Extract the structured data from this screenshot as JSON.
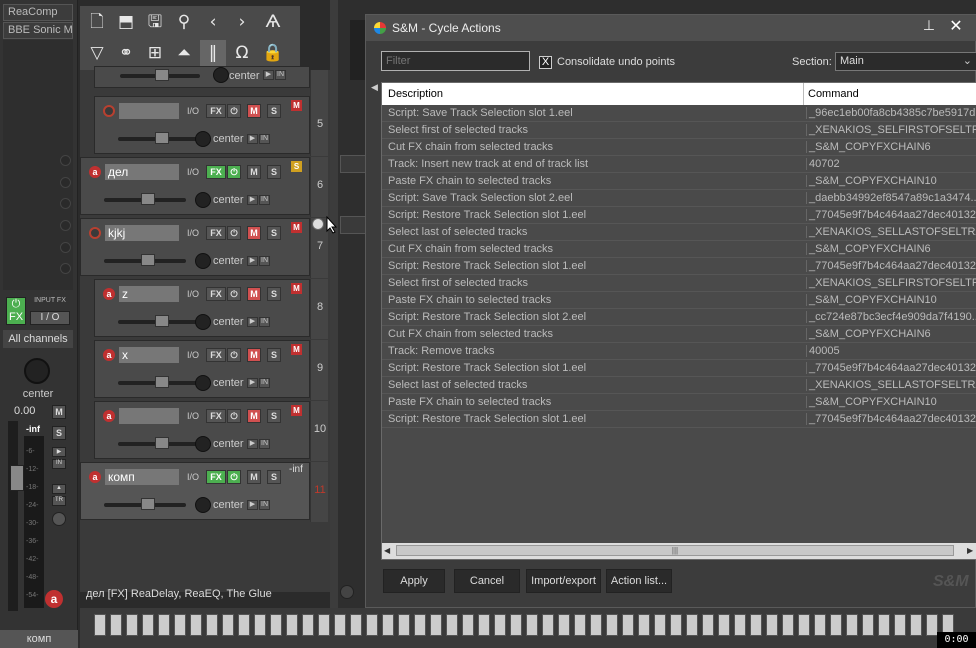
{
  "mixer": {
    "fx_slots": [
      "ReaComp",
      "BBE Sonic M"
    ],
    "fx_label": "FX",
    "input_fx_label": "INPUT FX",
    "io_label": "I / O",
    "all_channels": "All channels",
    "pan": "center",
    "volume": "0.00",
    "peak": "-inf",
    "m_label": "M",
    "s_label": "S",
    "in_label": "IN",
    "tr_label": "TR",
    "track_name": "комп",
    "scale": [
      "-6-",
      "-12-",
      "-18-",
      "-24-",
      "-30-",
      "-36-",
      "-42-",
      "-48-",
      "-54-"
    ]
  },
  "toolbar": {
    "row1": [
      "new-project",
      "open-project",
      "save-project",
      "attach",
      "back",
      "forward",
      "razor"
    ],
    "row2": [
      "filter",
      "link",
      "grid",
      "envelope",
      "snap-grid",
      "magnet",
      "lock"
    ]
  },
  "tracks": [
    {
      "num": "5",
      "name": "",
      "fx_on": false,
      "muted": true,
      "badge": "M"
    },
    {
      "num": "6",
      "name": "дел",
      "fx_on": true,
      "muted": false,
      "badge": "S"
    },
    {
      "num": "7",
      "name": "kjkj",
      "fx_on": false,
      "muted": true,
      "badge": "M"
    },
    {
      "num": "8",
      "name": "z",
      "fx_on": false,
      "muted": true,
      "badge": "M"
    },
    {
      "num": "9",
      "name": "x",
      "fx_on": false,
      "muted": true,
      "badge": "M"
    },
    {
      "num": "10",
      "name": "",
      "fx_on": false,
      "muted": true,
      "badge": "M"
    },
    {
      "num": "11",
      "name": "комп",
      "fx_on": true,
      "muted": false,
      "badge": "-inf"
    }
  ],
  "track_labels": {
    "io": "I/O",
    "fx": "FX",
    "m": "M",
    "s": "S",
    "center": "center",
    "in": "IN"
  },
  "status_bar": "дел [FX] ReaDelay, ReaEQ, The Glue",
  "dialog": {
    "title": "S&M - Cycle Actions",
    "filter_placeholder": "Filter",
    "consolidate_label": "Consolidate undo points",
    "consolidate_checked": "X",
    "section_label": "Section:",
    "section_value": "Main",
    "columns": {
      "description": "Description",
      "command": "Command"
    },
    "rows": [
      {
        "d": "Script: Save Track Selection slot 1.eel",
        "c": "_96ec1eb00fa8cb4385c7be5917d..."
      },
      {
        "d": "Select first of selected tracks",
        "c": "_XENAKIOS_SELFIRSTOFSELTRAX"
      },
      {
        "d": "Cut FX chain from selected tracks",
        "c": "_S&M_COPYFXCHAIN6"
      },
      {
        "d": "Track: Insert new track at end of track list",
        "c": "40702"
      },
      {
        "d": "Paste FX chain to selected tracks",
        "c": "_S&M_COPYFXCHAIN10"
      },
      {
        "d": "Script: Save Track Selection slot 2.eel",
        "c": "_daebb34992ef8547a89c1a3474..."
      },
      {
        "d": "Script: Restore Track Selection slot 1.eel",
        "c": "_77045e9f7b4c464aa27dec40132..."
      },
      {
        "d": "Select last of selected tracks",
        "c": "_XENAKIOS_SELLASTOFSELTRAX"
      },
      {
        "d": "Cut FX chain from selected tracks",
        "c": "_S&M_COPYFXCHAIN6"
      },
      {
        "d": "Script: Restore Track Selection slot 1.eel",
        "c": "_77045e9f7b4c464aa27dec40132..."
      },
      {
        "d": "Select first of selected tracks",
        "c": "_XENAKIOS_SELFIRSTOFSELTRAX"
      },
      {
        "d": "Paste FX chain to selected tracks",
        "c": "_S&M_COPYFXCHAIN10"
      },
      {
        "d": "Script: Restore Track Selection slot 2.eel",
        "c": "_cc724e87bc3ecf4e909da7f4190..."
      },
      {
        "d": "Cut FX chain from selected tracks",
        "c": "_S&M_COPYFXCHAIN6"
      },
      {
        "d": "Track: Remove tracks",
        "c": "40005"
      },
      {
        "d": "Script: Restore Track Selection slot 1.eel",
        "c": "_77045e9f7b4c464aa27dec40132..."
      },
      {
        "d": "Select last of selected tracks",
        "c": "_XENAKIOS_SELLASTOFSELTRAX"
      },
      {
        "d": "Paste FX chain to selected tracks",
        "c": "_S&M_COPYFXCHAIN10"
      },
      {
        "d": "Script: Restore Track Selection slot 1.eel",
        "c": "_77045e9f7b4c464aa27dec40132..."
      }
    ],
    "buttons": {
      "apply": "Apply",
      "cancel": "Cancel",
      "import_export": "Import/export",
      "action_list": "Action list..."
    },
    "watermark": "S&M",
    "pin_icon": "pin-icon",
    "close_icon": "close-icon"
  },
  "timer": "0:00"
}
